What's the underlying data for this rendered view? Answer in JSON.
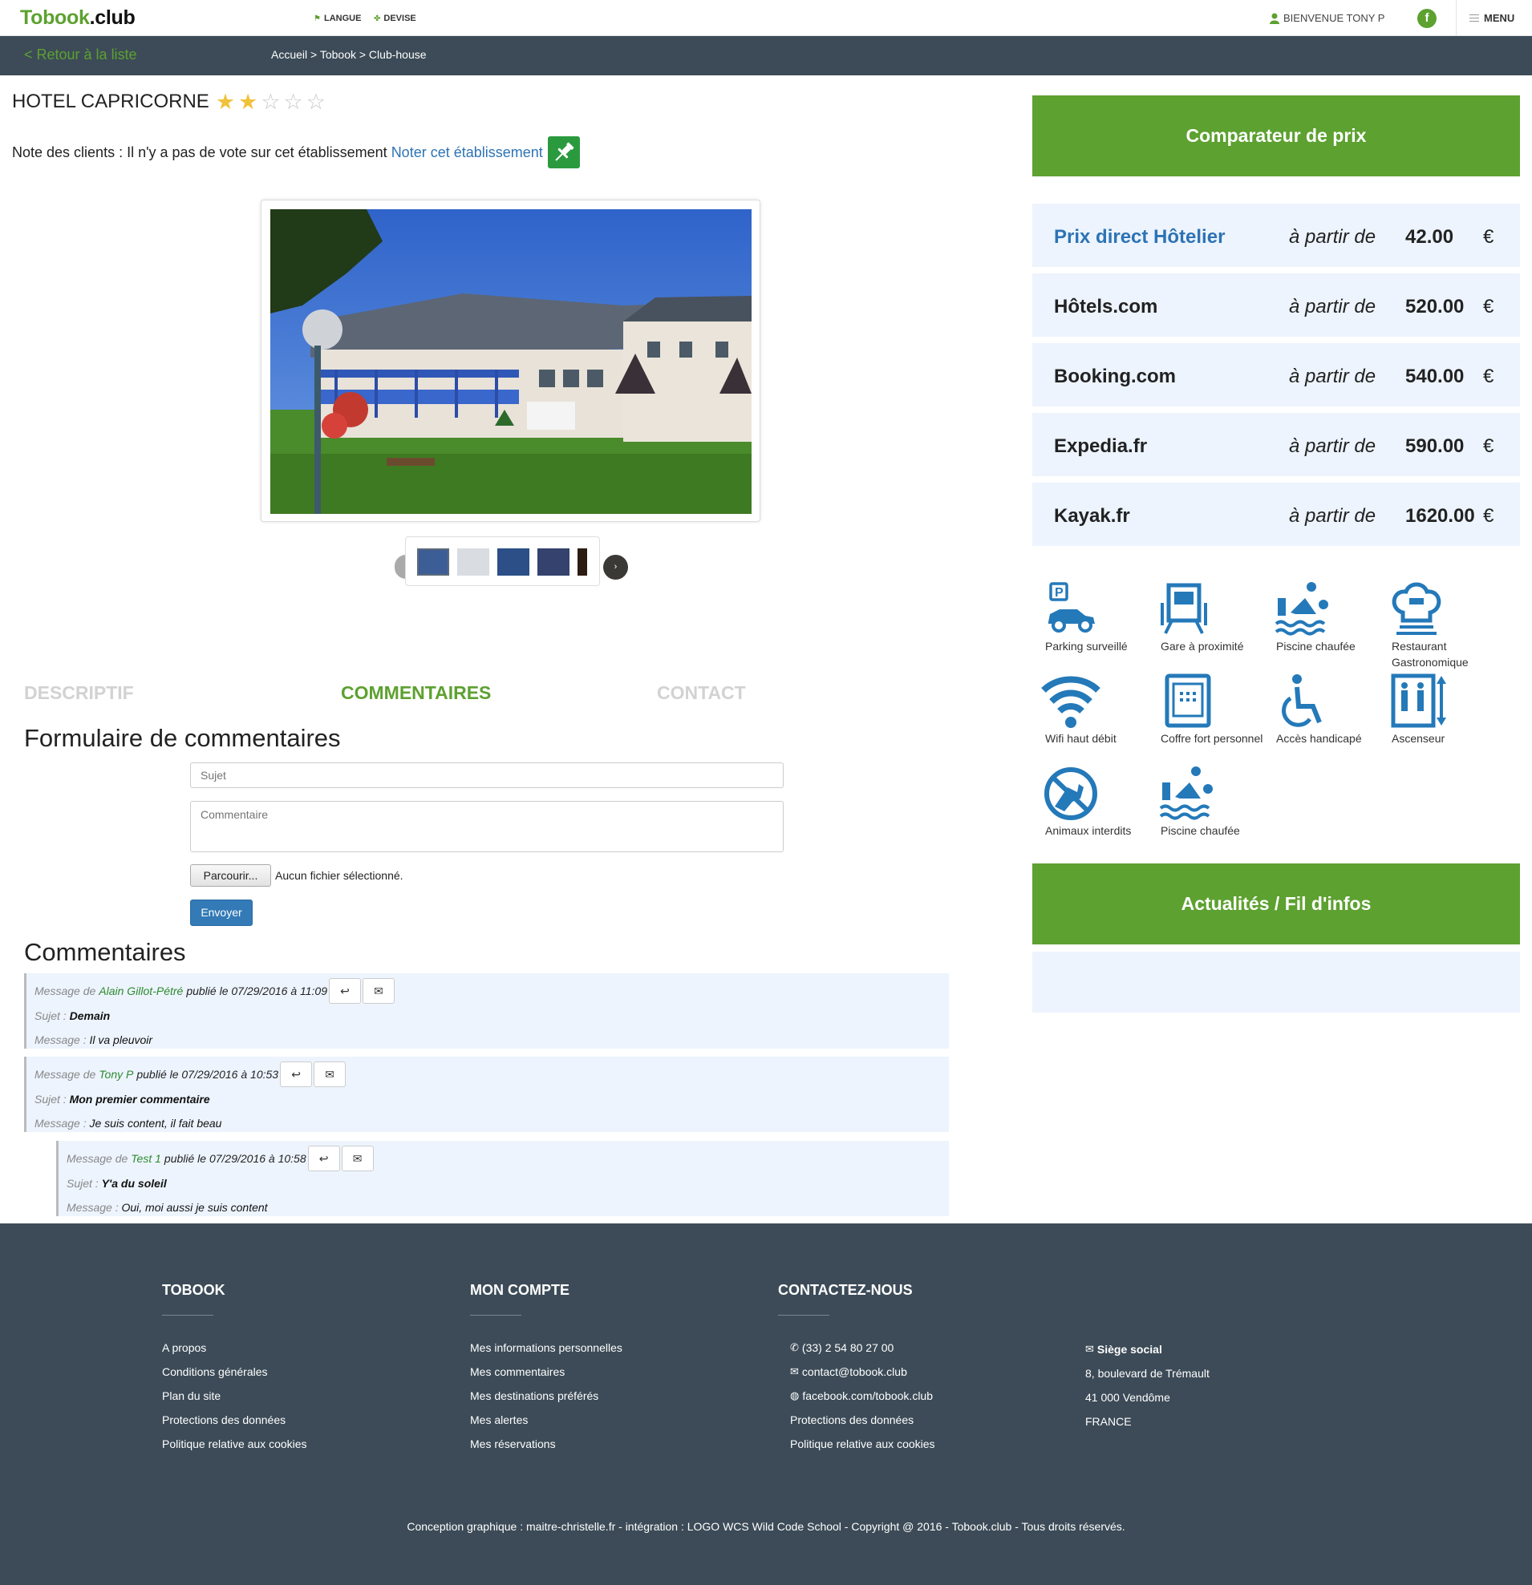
{
  "header": {
    "logo_part1": "Tobook",
    "logo_part2": ".club",
    "lang_label": "LANGUE",
    "currency_label": "DEVISE",
    "welcome": "BIENVENUE TONY P",
    "facebook_letter": "f",
    "menu_label": "MENU"
  },
  "subnav": {
    "back_label": "< Retour à la liste",
    "breadcrumb": "Accueil > Tobook > Club-house"
  },
  "hotel": {
    "name": "HOTEL CAPRICORNE",
    "stars_filled": 2,
    "stars_total": 5,
    "rating_text": "Note des clients : Il n'y a pas de vote sur cet établissement",
    "rate_link": "Noter cet établissement"
  },
  "tabs": [
    {
      "label": "DESCRIPTIF",
      "active": false
    },
    {
      "label": "COMMENTAIRES",
      "active": true
    },
    {
      "label": "CONTACT",
      "active": false
    }
  ],
  "form": {
    "heading": "Formulaire de commentaires",
    "subject_placeholder": "Sujet",
    "comment_placeholder": "Commentaire",
    "browse_label": "Parcourir...",
    "no_file": "Aucun fichier sélectionné.",
    "send_label": "Envoyer"
  },
  "comments": {
    "heading": "Commentaires",
    "prefix": "Message de",
    "subject_label": "Sujet :",
    "message_label": "Message :",
    "items": [
      {
        "author": "Alain Gillot-Pétré",
        "published": "publié le 07/29/2016 à 11:09",
        "subject": "Demain",
        "message": "Il va pleuvoir"
      },
      {
        "author": "Tony P",
        "published": "publié le 07/29/2016 à 10:53",
        "subject": "Mon premier commentaire",
        "message": "Je suis content, il fait beau"
      },
      {
        "author": "Test 1",
        "published": "publié le 07/29/2016 à 10:58",
        "subject": "Y'a du soleil",
        "message": "Oui, moi aussi je suis content"
      }
    ]
  },
  "comparator": {
    "title": "Comparateur de prix",
    "from_label": "à partir de",
    "currency": "€",
    "rows": [
      {
        "name": "Prix direct Hôtelier",
        "value": "42.00"
      },
      {
        "name": "Hôtels.com",
        "value": "520.00"
      },
      {
        "name": "Booking.com",
        "value": "540.00"
      },
      {
        "name": "Expedia.fr",
        "value": "590.00"
      },
      {
        "name": "Kayak.fr",
        "value": "1620.00"
      }
    ]
  },
  "amenities": [
    {
      "label": "Parking surveillé",
      "icon": "parking-icon"
    },
    {
      "label": "Gare à proximité",
      "icon": "train-icon"
    },
    {
      "label": "Piscine chaufée",
      "icon": "pool-icon"
    },
    {
      "label": "Restaurant Gastronomique",
      "icon": "chef-hat-icon"
    },
    {
      "label": "Wifi haut débit",
      "icon": "wifi-icon"
    },
    {
      "label": "Coffre fort personnel",
      "icon": "safe-icon"
    },
    {
      "label": "Accès handicapé",
      "icon": "wheelchair-icon"
    },
    {
      "label": "Ascenseur",
      "icon": "elevator-icon"
    },
    {
      "label": "Animaux interdits",
      "icon": "no-pets-icon"
    },
    {
      "label": "Piscine chaufée",
      "icon": "pool-icon"
    }
  ],
  "news": {
    "title": "Actualités / Fil d'infos"
  },
  "footer": {
    "col1": {
      "title": "TOBOOK",
      "items": [
        "A propos",
        "Conditions générales",
        "Plan du site",
        "Protections des données",
        "Politique relative aux cookies"
      ]
    },
    "col2": {
      "title": "MON COMPTE",
      "items": [
        "Mes informations personnelles",
        "Mes commentaires",
        "Mes destinations préférés",
        "Mes alertes",
        "Mes réservations"
      ]
    },
    "col3": {
      "title": "CONTACTEZ-NOUS",
      "items": [
        "(33) 2 54 80 27 00",
        "contact@tobook.club",
        "facebook.com/tobook.club",
        "Protections des données",
        "Politique relative aux cookies"
      ]
    },
    "col4": {
      "items": [
        "Siège social",
        "8, boulevard de Trémault",
        "41 000 Vendôme",
        "FRANCE"
      ]
    },
    "copyright": "Conception graphique : maitre-christelle.fr - intégration : LOGO WCS Wild Code School - Copyright @ 2016 - Tobook.club - Tous droits réservés."
  },
  "colors": {
    "brand_green": "#5da130",
    "dark_slate": "#3c4b57",
    "link_blue": "#2d73b4",
    "icon_blue": "#2479b9",
    "panel_blue": "#edf4fe"
  }
}
